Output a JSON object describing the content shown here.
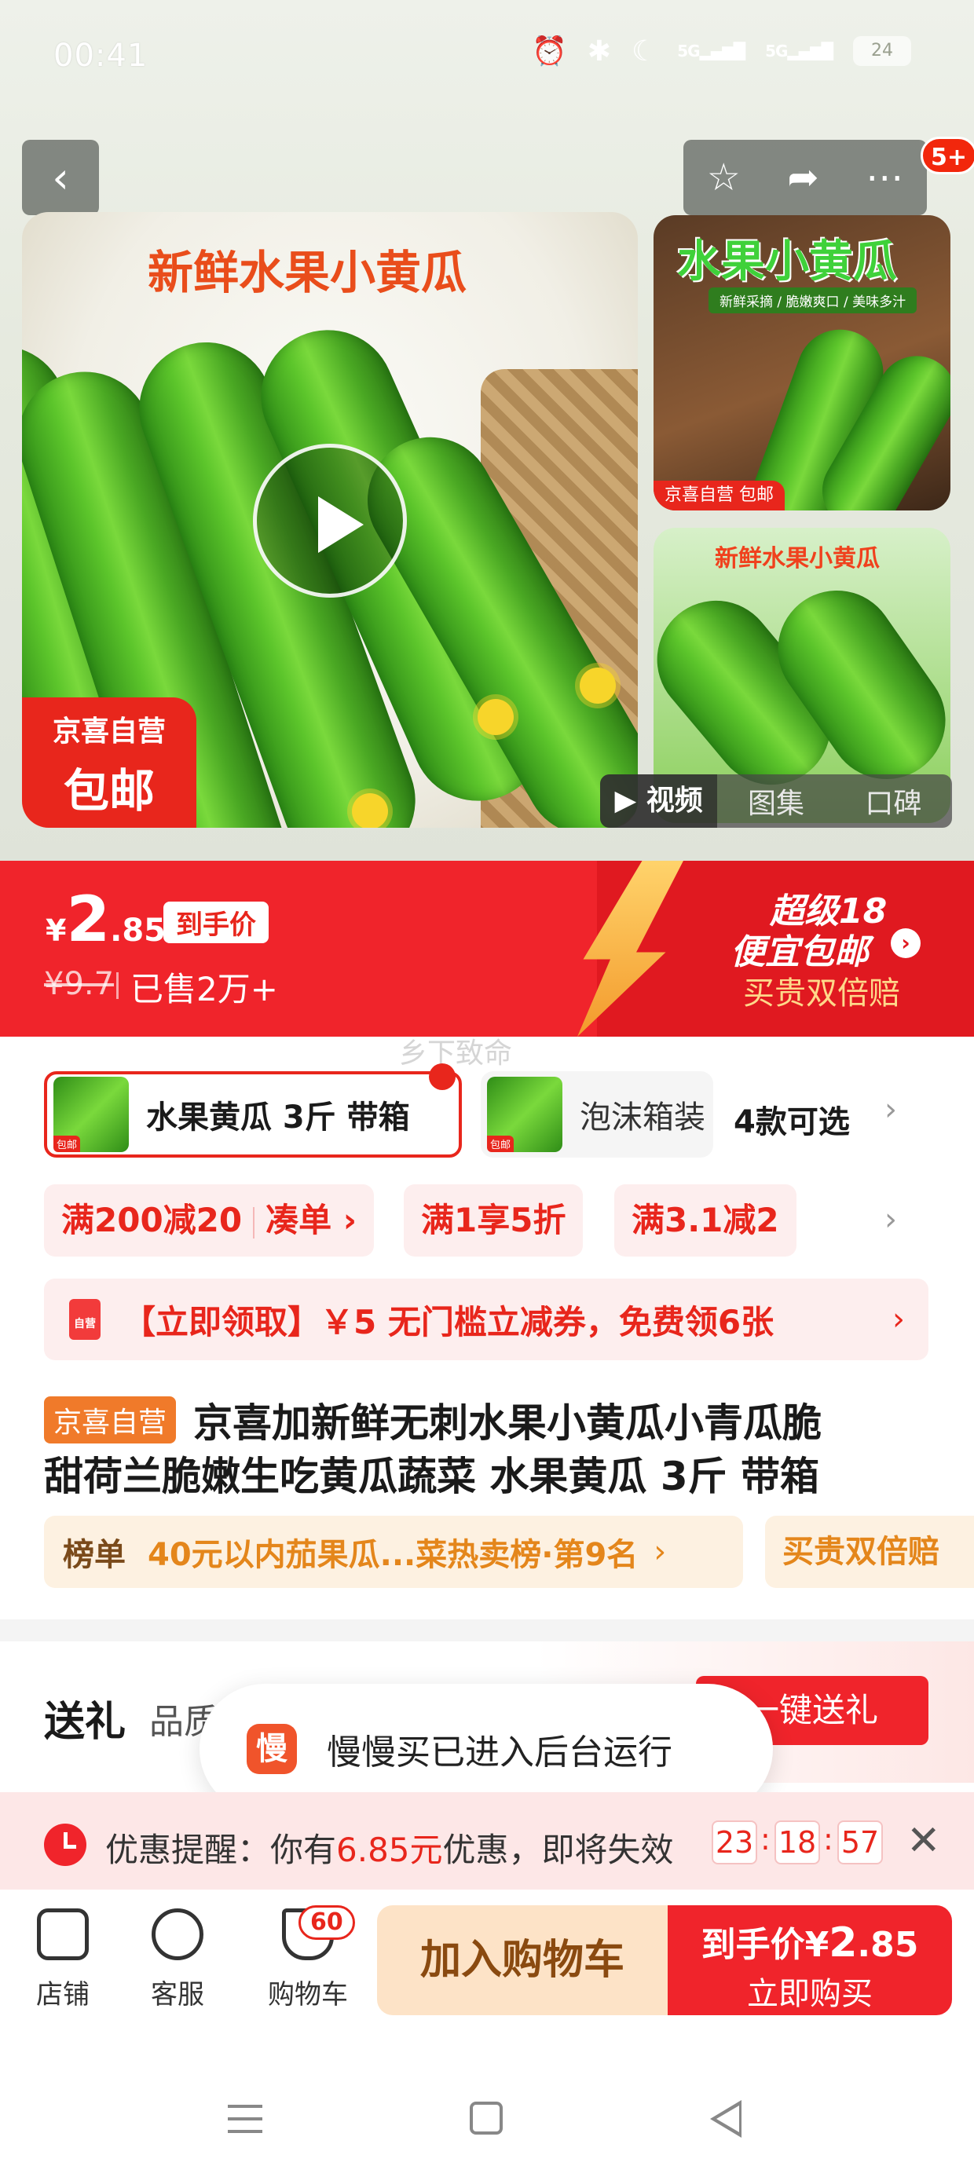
{
  "status_bar": {
    "time": "00:41",
    "signal_1": "5G",
    "signal_2": "5G",
    "battery": "24"
  },
  "gallery": {
    "badge_count": "5+",
    "main_title": "新鲜水果小黄瓜",
    "self_badge_line1": "京喜自营",
    "self_badge_line2": "包邮",
    "thumb1_title": "水果小黄瓜",
    "thumb1_sub": "新鲜采摘 / 脆嫩爽口 / 美味多汁",
    "thumb1_badge": "京喜自营 包邮",
    "thumb2_title": "新鲜水果小黄瓜",
    "tabs": [
      "视频",
      "图集",
      "口碑"
    ]
  },
  "price": {
    "currency": "¥",
    "integer": "2",
    "decimal": ".85",
    "tag": "到手价",
    "original": "¥9.7",
    "sold": "已售2万+",
    "super_line1": "超级18",
    "super_line2": "便宜包邮",
    "super_line3": "买贵双倍赔"
  },
  "watermark": "乡下致命",
  "variants": {
    "selected_label": "水果黄瓜 3斤 带箱",
    "other_label": "泡沫箱装",
    "count_label": "4款可选"
  },
  "promos": {
    "pill1_main": "满200减20",
    "pill1_action": "凑单 ›",
    "pill2": "满1享5折",
    "pill3": "满3.1减2"
  },
  "coupon": {
    "icon_text": "自营",
    "text": "【立即领取】￥5 无门槛立减券，免费领6张"
  },
  "product": {
    "self_tag": "京喜自营",
    "title_line1": "京喜加新鲜无刺水果小黄瓜小青瓜脆",
    "title_line2": "甜荷兰脆嫩生吃黄瓜蔬菜 水果黄瓜 3斤 带箱"
  },
  "rank": {
    "label": "榜单",
    "text": "40元以内茄果瓜...菜热卖榜·第9名",
    "guarantee": "买贵双倍赔"
  },
  "gift": {
    "title": "送礼",
    "subtitle": "品质",
    "button": "一键送礼"
  },
  "toast": {
    "icon": "慢",
    "text": "慢慢买已进入后台运行"
  },
  "reminder": {
    "prefix": "优惠提醒：你有",
    "amount": "6.85元",
    "suffix": "优惠，即将失效",
    "hours": "23",
    "minutes": "18",
    "seconds": "57"
  },
  "bottom": {
    "shop": "店铺",
    "service": "客服",
    "cart": "购物车",
    "cart_count": "60",
    "add_cart": "加入购物车",
    "buy_price_label": "到手价",
    "buy_currency": "¥",
    "buy_int": "2",
    "buy_dec": ".85",
    "buy_now": "立即购买"
  }
}
